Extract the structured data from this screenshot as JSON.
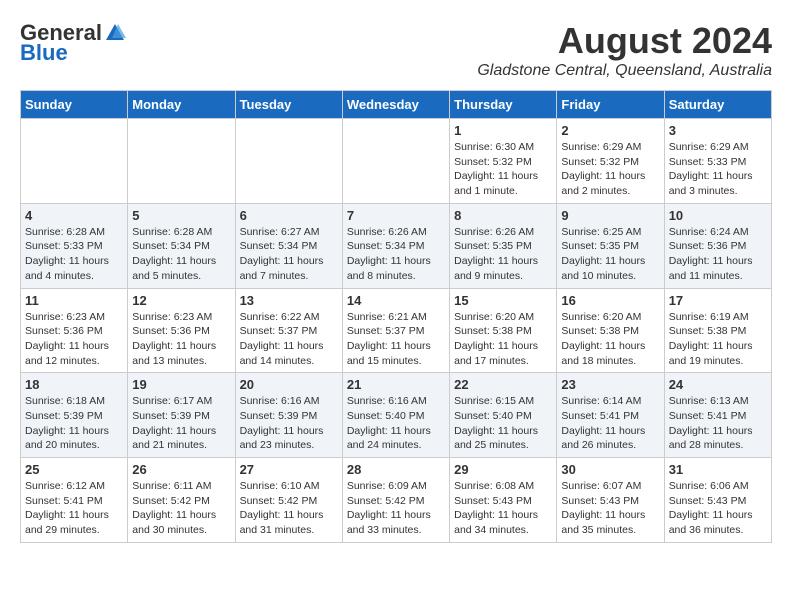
{
  "header": {
    "logo_general": "General",
    "logo_blue": "Blue",
    "month_year": "August 2024",
    "location": "Gladstone Central, Queensland, Australia"
  },
  "days_of_week": [
    "Sunday",
    "Monday",
    "Tuesday",
    "Wednesday",
    "Thursday",
    "Friday",
    "Saturday"
  ],
  "weeks": [
    [
      {
        "day": "",
        "info": ""
      },
      {
        "day": "",
        "info": ""
      },
      {
        "day": "",
        "info": ""
      },
      {
        "day": "",
        "info": ""
      },
      {
        "day": "1",
        "info": "Sunrise: 6:30 AM\nSunset: 5:32 PM\nDaylight: 11 hours and 1 minute."
      },
      {
        "day": "2",
        "info": "Sunrise: 6:29 AM\nSunset: 5:32 PM\nDaylight: 11 hours and 2 minutes."
      },
      {
        "day": "3",
        "info": "Sunrise: 6:29 AM\nSunset: 5:33 PM\nDaylight: 11 hours and 3 minutes."
      }
    ],
    [
      {
        "day": "4",
        "info": "Sunrise: 6:28 AM\nSunset: 5:33 PM\nDaylight: 11 hours and 4 minutes."
      },
      {
        "day": "5",
        "info": "Sunrise: 6:28 AM\nSunset: 5:34 PM\nDaylight: 11 hours and 5 minutes."
      },
      {
        "day": "6",
        "info": "Sunrise: 6:27 AM\nSunset: 5:34 PM\nDaylight: 11 hours and 7 minutes."
      },
      {
        "day": "7",
        "info": "Sunrise: 6:26 AM\nSunset: 5:34 PM\nDaylight: 11 hours and 8 minutes."
      },
      {
        "day": "8",
        "info": "Sunrise: 6:26 AM\nSunset: 5:35 PM\nDaylight: 11 hours and 9 minutes."
      },
      {
        "day": "9",
        "info": "Sunrise: 6:25 AM\nSunset: 5:35 PM\nDaylight: 11 hours and 10 minutes."
      },
      {
        "day": "10",
        "info": "Sunrise: 6:24 AM\nSunset: 5:36 PM\nDaylight: 11 hours and 11 minutes."
      }
    ],
    [
      {
        "day": "11",
        "info": "Sunrise: 6:23 AM\nSunset: 5:36 PM\nDaylight: 11 hours and 12 minutes."
      },
      {
        "day": "12",
        "info": "Sunrise: 6:23 AM\nSunset: 5:36 PM\nDaylight: 11 hours and 13 minutes."
      },
      {
        "day": "13",
        "info": "Sunrise: 6:22 AM\nSunset: 5:37 PM\nDaylight: 11 hours and 14 minutes."
      },
      {
        "day": "14",
        "info": "Sunrise: 6:21 AM\nSunset: 5:37 PM\nDaylight: 11 hours and 15 minutes."
      },
      {
        "day": "15",
        "info": "Sunrise: 6:20 AM\nSunset: 5:38 PM\nDaylight: 11 hours and 17 minutes."
      },
      {
        "day": "16",
        "info": "Sunrise: 6:20 AM\nSunset: 5:38 PM\nDaylight: 11 hours and 18 minutes."
      },
      {
        "day": "17",
        "info": "Sunrise: 6:19 AM\nSunset: 5:38 PM\nDaylight: 11 hours and 19 minutes."
      }
    ],
    [
      {
        "day": "18",
        "info": "Sunrise: 6:18 AM\nSunset: 5:39 PM\nDaylight: 11 hours and 20 minutes."
      },
      {
        "day": "19",
        "info": "Sunrise: 6:17 AM\nSunset: 5:39 PM\nDaylight: 11 hours and 21 minutes."
      },
      {
        "day": "20",
        "info": "Sunrise: 6:16 AM\nSunset: 5:39 PM\nDaylight: 11 hours and 23 minutes."
      },
      {
        "day": "21",
        "info": "Sunrise: 6:16 AM\nSunset: 5:40 PM\nDaylight: 11 hours and 24 minutes."
      },
      {
        "day": "22",
        "info": "Sunrise: 6:15 AM\nSunset: 5:40 PM\nDaylight: 11 hours and 25 minutes."
      },
      {
        "day": "23",
        "info": "Sunrise: 6:14 AM\nSunset: 5:41 PM\nDaylight: 11 hours and 26 minutes."
      },
      {
        "day": "24",
        "info": "Sunrise: 6:13 AM\nSunset: 5:41 PM\nDaylight: 11 hours and 28 minutes."
      }
    ],
    [
      {
        "day": "25",
        "info": "Sunrise: 6:12 AM\nSunset: 5:41 PM\nDaylight: 11 hours and 29 minutes."
      },
      {
        "day": "26",
        "info": "Sunrise: 6:11 AM\nSunset: 5:42 PM\nDaylight: 11 hours and 30 minutes."
      },
      {
        "day": "27",
        "info": "Sunrise: 6:10 AM\nSunset: 5:42 PM\nDaylight: 11 hours and 31 minutes."
      },
      {
        "day": "28",
        "info": "Sunrise: 6:09 AM\nSunset: 5:42 PM\nDaylight: 11 hours and 33 minutes."
      },
      {
        "day": "29",
        "info": "Sunrise: 6:08 AM\nSunset: 5:43 PM\nDaylight: 11 hours and 34 minutes."
      },
      {
        "day": "30",
        "info": "Sunrise: 6:07 AM\nSunset: 5:43 PM\nDaylight: 11 hours and 35 minutes."
      },
      {
        "day": "31",
        "info": "Sunrise: 6:06 AM\nSunset: 5:43 PM\nDaylight: 11 hours and 36 minutes."
      }
    ]
  ]
}
